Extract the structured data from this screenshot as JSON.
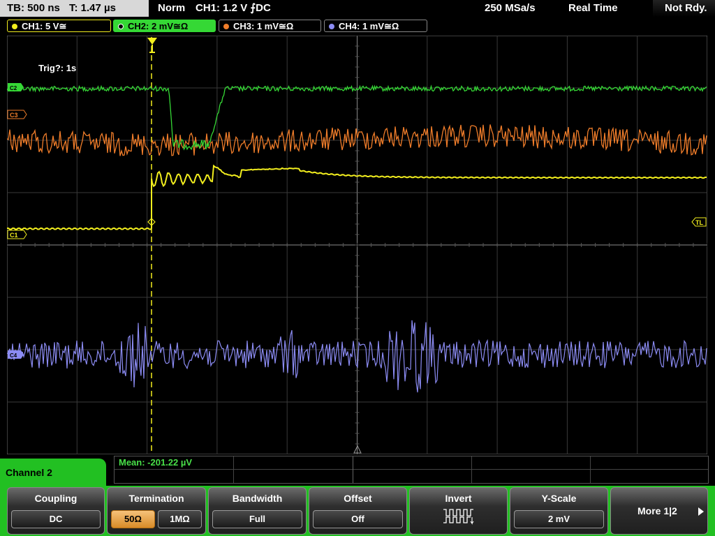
{
  "status_bar": {
    "timebase": "TB: 500 ns",
    "trigger_time": "T: 1.47 µs",
    "mode": "Norm",
    "trigger": "CH1: 1.2 V ⨍DC",
    "sample_rate": "250 MSa/s",
    "acq_mode": "Real Time",
    "status": "Not Rdy."
  },
  "channels": [
    {
      "label": "CH1: 5 V≅",
      "color": "#f2ee1e"
    },
    {
      "label": "CH2: 2 mV≅Ω",
      "color": "#35d835"
    },
    {
      "label": "CH3: 1 mV≅Ω",
      "color": "#f07d2a"
    },
    {
      "label": "CH4: 1 mV≅Ω",
      "color": "#8c8cf4"
    }
  ],
  "display": {
    "trig_label": "Trig?: 1s",
    "markers": {
      "c1": "C1",
      "c2": "C2",
      "c3": "C3",
      "c4": "C4",
      "tl": "TL",
      "trig": "T"
    }
  },
  "measurement": {
    "mean": "Mean: -201.22 µV"
  },
  "menu": {
    "title": "Channel 2",
    "coupling": {
      "title": "Coupling",
      "value": "DC"
    },
    "termination": {
      "title": "Termination",
      "option1": "50Ω",
      "option2": "1MΩ"
    },
    "bandwidth": {
      "title": "Bandwidth",
      "value": "Full"
    },
    "offset": {
      "title": "Offset",
      "value": "Off"
    },
    "invert": {
      "title": "Invert"
    },
    "yscale": {
      "title": "Y-Scale",
      "value": "2 mV"
    },
    "more": {
      "label": "More 1|2"
    }
  }
}
